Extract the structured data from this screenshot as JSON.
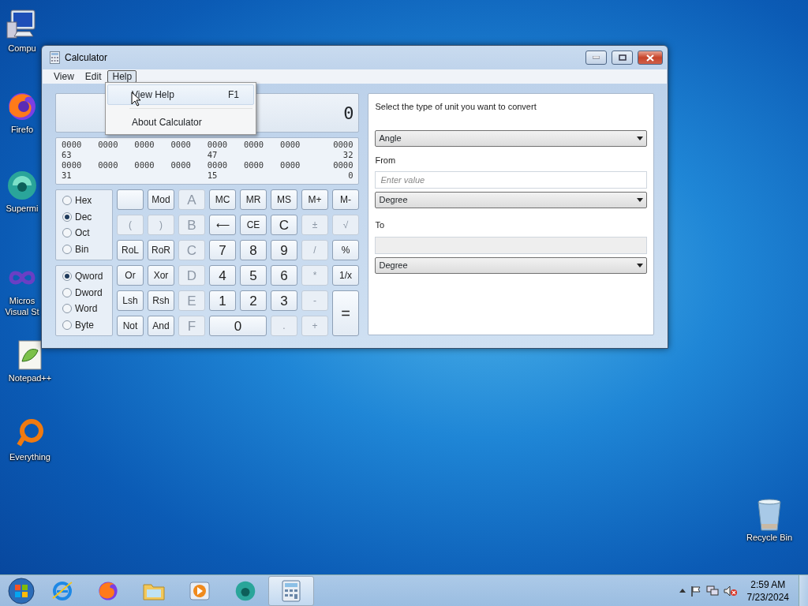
{
  "desktop_icons": [
    {
      "kind": "computer",
      "lines": [
        "Compu"
      ]
    },
    {
      "kind": "firefox",
      "lines": [
        "Firefo"
      ]
    },
    {
      "kind": "supermium",
      "lines": [
        "Supermi"
      ]
    },
    {
      "kind": "visualstudio",
      "lines": [
        "Micros",
        "Visual St"
      ]
    },
    {
      "kind": "notepad",
      "lines": [
        "Notepad++"
      ]
    },
    {
      "kind": "everything",
      "lines": [
        "Everything"
      ]
    },
    {
      "kind": "recycle",
      "lines": [
        "Recycle Bin"
      ]
    }
  ],
  "window": {
    "title": "Calculator",
    "menu": [
      {
        "label": "View",
        "selected": false
      },
      {
        "label": "Edit",
        "selected": false
      },
      {
        "label": "Help",
        "selected": true
      }
    ],
    "help_menu": [
      {
        "label": "View Help",
        "shortcut": "F1",
        "selected": true
      },
      {
        "label": "About Calculator",
        "selected": false
      }
    ],
    "display": "0",
    "bits": [
      {
        "groups": [
          "0000",
          "0000",
          "0000",
          "0000",
          "0000",
          "0000",
          "0000",
          "0000"
        ],
        "positions": [
          "63",
          "47",
          "32"
        ]
      },
      {
        "groups": [
          "0000",
          "0000",
          "0000",
          "0000",
          "0000",
          "0000",
          "0000",
          "0000"
        ],
        "positions": [
          "31",
          "15",
          "0"
        ]
      }
    ],
    "bases": [
      {
        "label": "Hex",
        "selected": false
      },
      {
        "label": "Dec",
        "selected": true
      },
      {
        "label": "Oct",
        "selected": false
      },
      {
        "label": "Bin",
        "selected": false
      }
    ],
    "word_sizes": [
      {
        "label": "Qword",
        "selected": true
      },
      {
        "label": "Dword",
        "selected": false
      },
      {
        "label": "Word",
        "selected": false
      },
      {
        "label": "Byte",
        "selected": false
      }
    ],
    "keys": [
      {
        "kind": "blank",
        "disabled": false
      },
      {
        "kind": "key",
        "label": "Mod",
        "disabled": false
      },
      {
        "kind": "key",
        "label": "A",
        "disabled": true
      },
      {
        "kind": "key",
        "label": "MC",
        "disabled": false
      },
      {
        "kind": "key",
        "label": "MR",
        "disabled": false
      },
      {
        "kind": "key",
        "label": "MS",
        "disabled": false
      },
      {
        "kind": "key",
        "label": "M+",
        "disabled": false
      },
      {
        "kind": "key",
        "label": "M-",
        "disabled": false
      },
      {
        "kind": "key",
        "label": "(",
        "disabled": true
      },
      {
        "kind": "key",
        "label": ")",
        "disabled": true
      },
      {
        "kind": "key",
        "label": "B",
        "disabled": true
      },
      {
        "kind": "key",
        "label": "⟵",
        "disabled": false
      },
      {
        "kind": "key",
        "label": "CE",
        "disabled": false
      },
      {
        "kind": "key",
        "label": "C",
        "disabled": false
      },
      {
        "kind": "key",
        "label": "±",
        "disabled": true
      },
      {
        "kind": "key",
        "label": "√",
        "disabled": true
      },
      {
        "kind": "key",
        "label": "RoL",
        "disabled": false
      },
      {
        "kind": "key",
        "label": "RoR",
        "disabled": false
      },
      {
        "kind": "key",
        "label": "C",
        "disabled": true
      },
      {
        "kind": "key",
        "label": "7",
        "disabled": false
      },
      {
        "kind": "key",
        "label": "8",
        "disabled": false
      },
      {
        "kind": "key",
        "label": "9",
        "disabled": false
      },
      {
        "kind": "key",
        "label": "/",
        "disabled": true
      },
      {
        "kind": "key",
        "label": "%",
        "disabled": false
      },
      {
        "kind": "key",
        "label": "Or",
        "disabled": false
      },
      {
        "kind": "key",
        "label": "Xor",
        "disabled": false
      },
      {
        "kind": "key",
        "label": "D",
        "disabled": true
      },
      {
        "kind": "key",
        "label": "4",
        "disabled": false
      },
      {
        "kind": "key",
        "label": "5",
        "disabled": false
      },
      {
        "kind": "key",
        "label": "6",
        "disabled": false
      },
      {
        "kind": "key",
        "label": "*",
        "disabled": true
      },
      {
        "kind": "key",
        "label": "1/x",
        "disabled": false
      },
      {
        "kind": "key",
        "label": "Lsh",
        "disabled": false
      },
      {
        "kind": "key",
        "label": "Rsh",
        "disabled": false
      },
      {
        "kind": "key",
        "label": "E",
        "disabled": true
      },
      {
        "kind": "key",
        "label": "1",
        "disabled": false
      },
      {
        "kind": "key",
        "label": "2",
        "disabled": false
      },
      {
        "kind": "key",
        "label": "3",
        "disabled": false
      },
      {
        "kind": "key",
        "label": "-",
        "disabled": true
      },
      {
        "kind": "tall",
        "label": "=",
        "disabled": false
      },
      {
        "kind": "key",
        "label": "Not",
        "disabled": false
      },
      {
        "kind": "key",
        "label": "And",
        "disabled": false
      },
      {
        "kind": "key",
        "label": "F",
        "disabled": true
      },
      {
        "kind": "wide",
        "label": "0",
        "disabled": false
      },
      {
        "kind": "key",
        "label": ".",
        "disabled": true
      },
      {
        "kind": "key",
        "label": "+",
        "disabled": true
      }
    ],
    "converter": {
      "instruction": "Select the type of unit you want to convert",
      "type": "Angle",
      "from_label": "From",
      "from_placeholder": "Enter value",
      "from_unit": "Degree",
      "to_label": "To",
      "to_unit": "Degree"
    }
  },
  "taskbar": {
    "apps": [
      {
        "kind": "ie",
        "selected": false
      },
      {
        "kind": "firefox",
        "selected": false
      },
      {
        "kind": "folder",
        "selected": false
      },
      {
        "kind": "media",
        "selected": false
      },
      {
        "kind": "supermium",
        "selected": false
      },
      {
        "kind": "calculator",
        "selected": true
      }
    ],
    "time": "2:59 AM",
    "date": "7/23/2024"
  }
}
